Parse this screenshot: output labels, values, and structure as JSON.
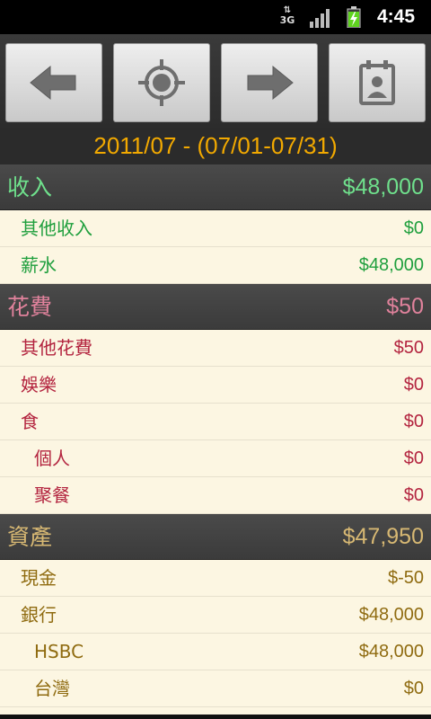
{
  "status_bar": {
    "network": "3G",
    "time": "4:45",
    "icons": [
      "network-3g-icon",
      "signal-bars-icon",
      "battery-charging-icon"
    ]
  },
  "toolbar": {
    "buttons": [
      {
        "name": "previous-button",
        "icon": "arrow-left-icon"
      },
      {
        "name": "current-button",
        "icon": "target-crosshair-icon"
      },
      {
        "name": "next-button",
        "icon": "arrow-right-icon"
      },
      {
        "name": "calendar-button",
        "icon": "calendar-contact-icon"
      }
    ]
  },
  "period": "2011/07 - (07/01-07/31)",
  "colors": {
    "income": "#6fe08c",
    "income_item": "#1f9f3d",
    "expense": "#e0829c",
    "expense_item": "#b3243f",
    "asset": "#d7b873",
    "asset_item": "#8f6b10",
    "period": "#f2a900"
  },
  "sections": [
    {
      "name": "收入",
      "amount": "$48,000",
      "items": [
        {
          "name": "其他收入",
          "amount": "$0",
          "level": 1
        },
        {
          "name": "薪水",
          "amount": "$48,000",
          "level": 1
        }
      ]
    },
    {
      "name": "花費",
      "amount": "$50",
      "items": [
        {
          "name": "其他花費",
          "amount": "$50",
          "level": 1
        },
        {
          "name": "娛樂",
          "amount": "$0",
          "level": 1
        },
        {
          "name": "食",
          "amount": "$0",
          "level": 1
        },
        {
          "name": "個人",
          "amount": "$0",
          "level": 2
        },
        {
          "name": "聚餐",
          "amount": "$0",
          "level": 2
        }
      ]
    },
    {
      "name": "資產",
      "amount": "$47,950",
      "items": [
        {
          "name": "現金",
          "amount": "$-50",
          "level": 1
        },
        {
          "name": "銀行",
          "amount": "$48,000",
          "level": 1
        },
        {
          "name": "HSBC",
          "amount": "$48,000",
          "level": 2
        },
        {
          "name": "台灣",
          "amount": "$0",
          "level": 2
        }
      ]
    }
  ]
}
